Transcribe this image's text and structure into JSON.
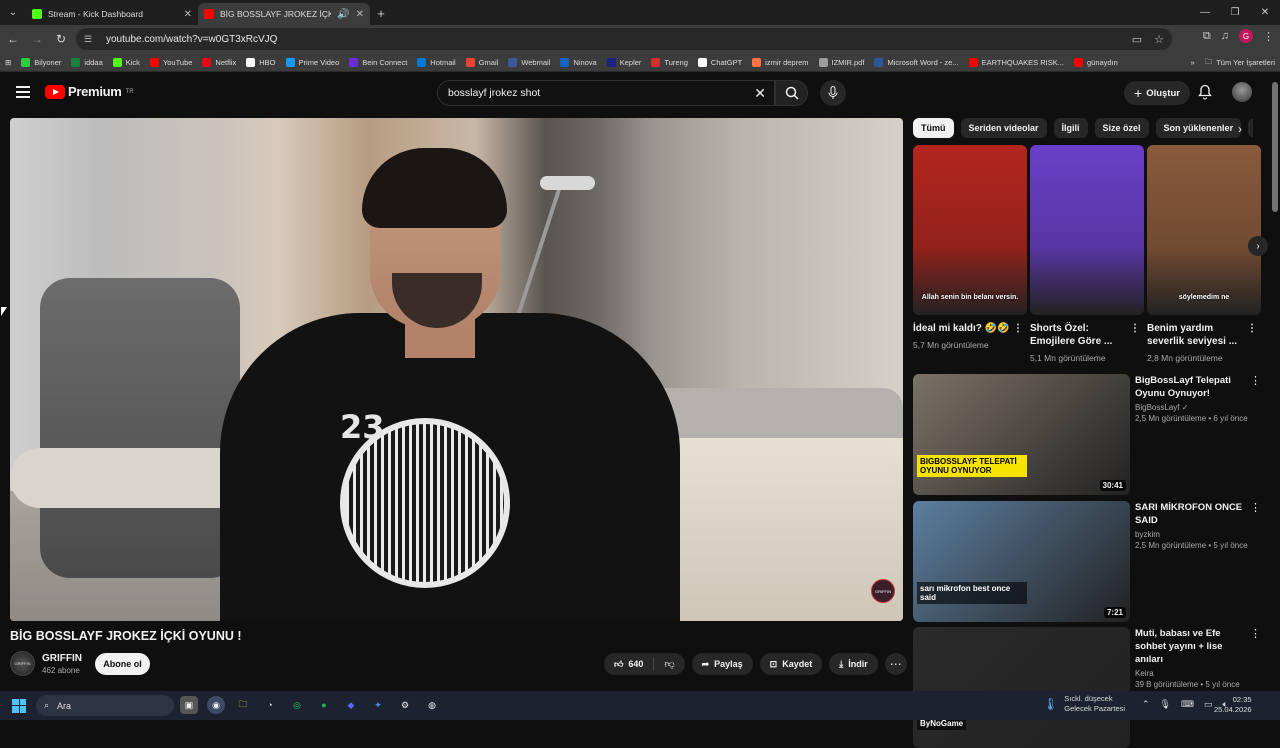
{
  "browser": {
    "tabs": [
      {
        "title": "Stream - Kick Dashboard",
        "color": "#53fc18"
      },
      {
        "title": "BİG BOSSLAYF JROKEZ İÇKİ",
        "color": "#ff0000"
      }
    ],
    "url": "youtube.com/watch?v=w0GT3xRcVJQ",
    "profile_initial": "G",
    "bookmarks": [
      {
        "label": "Bilyoner",
        "color": "#2ecc40"
      },
      {
        "label": "iddaa",
        "color": "#1a7f3a"
      },
      {
        "label": "Kick",
        "color": "#53fc18"
      },
      {
        "label": "YouTube",
        "color": "#ff0000"
      },
      {
        "label": "Netflix",
        "color": "#e50914"
      },
      {
        "label": "HBO",
        "color": "#ffffff"
      },
      {
        "label": "Prime Video",
        "color": "#1399ff"
      },
      {
        "label": "Bein Connect",
        "color": "#6c2bd9"
      },
      {
        "label": "Hotmail",
        "color": "#0078d4"
      },
      {
        "label": "Gmail",
        "color": "#ea4335"
      },
      {
        "label": "Webmail",
        "color": "#3b5998"
      },
      {
        "label": "Ninova",
        "color": "#1565c0"
      },
      {
        "label": "Kepler",
        "color": "#1a237e"
      },
      {
        "label": "Tureng",
        "color": "#d32f2f"
      },
      {
        "label": "ChatGPT",
        "color": "#ffffff"
      },
      {
        "label": "izmir deprem",
        "color": "#ff7043"
      },
      {
        "label": "IZMIR.pdf",
        "color": "#9e9e9e"
      },
      {
        "label": "Microsoft Word - ze...",
        "color": "#2b579a"
      },
      {
        "label": "EARTHQUAKES RISK...",
        "color": "#ff0000"
      },
      {
        "label": "günaydın",
        "color": "#ff0000"
      }
    ],
    "all_bookmarks": "Tüm Yer İşaretleri"
  },
  "youtube": {
    "logo_text": "Premium",
    "logo_sup": "TR",
    "search_query": "bosslayf jrokez shot",
    "create_label": "Oluştur"
  },
  "video": {
    "title": "BİG BOSSLAYF JROKEZ İÇKİ OYUNU !",
    "jersey_number": "23",
    "watermark": "GRIFFIN",
    "channel": "GRIFFIN",
    "subscribers": "462 abone",
    "subscribe_label": "Abone ol",
    "likes": "640",
    "share_label": "Paylaş",
    "save_label": "Kaydet",
    "download_label": "İndir"
  },
  "chips": [
    "Tümü",
    "Seriden videolar",
    "İlgili",
    "Size özel",
    "Son yüklenenler",
    "L"
  ],
  "shorts": [
    {
      "title": "İdeal mi kaldı? 🤣🤣",
      "views": "5,7 Mn görüntüleme",
      "caption": "Allah senin bin belanı versin.",
      "bg": "#b3261e"
    },
    {
      "title": "Shorts Özel: Emojilere Göre ...",
      "views": "5,1 Mn görüntüleme",
      "caption": "",
      "bg": "#6a3fc8"
    },
    {
      "title": "Benim yardım severlik seviyesi ...",
      "views": "2,8 Mn görüntüleme",
      "caption": "söylemedim ne",
      "bg": "#8a5a3c"
    }
  ],
  "recommendations": [
    {
      "title": "BigBossLayf Telepati Oyunu Oynuyor!",
      "channel": "BigBossLayf ✓",
      "views": "2,5 Mn görüntüleme",
      "age": "6 yıl önce",
      "duration": "30:41",
      "thumb_text": "BIGBOSSLAYF TELEPATİ OYUNU OYNUYOR",
      "bg": "#7a7266"
    },
    {
      "title": "SARI MİKROFON ONCE SAID",
      "channel": "byzkim",
      "views": "2,5 Mn görüntüleme",
      "age": "5 yıl önce",
      "duration": "7:21",
      "thumb_text": "sarı mikrofon best once said",
      "bg": "#5c7fa0"
    },
    {
      "title": "Muti, babası ve Efe sohbet yayını + lise anıları",
      "channel": "Keira",
      "views": "39 B görüntüleme",
      "age": "5 yıl önce",
      "duration": "",
      "thumb_text": "ByNoGame",
      "bg": "#2a2a2a"
    }
  ],
  "taskbar": {
    "search": "Ara",
    "weather_line1": "Sıckl. düşecek",
    "weather_line2": "Gelecek Pazartesi",
    "time": "02:35",
    "date": "25.04.2026"
  }
}
